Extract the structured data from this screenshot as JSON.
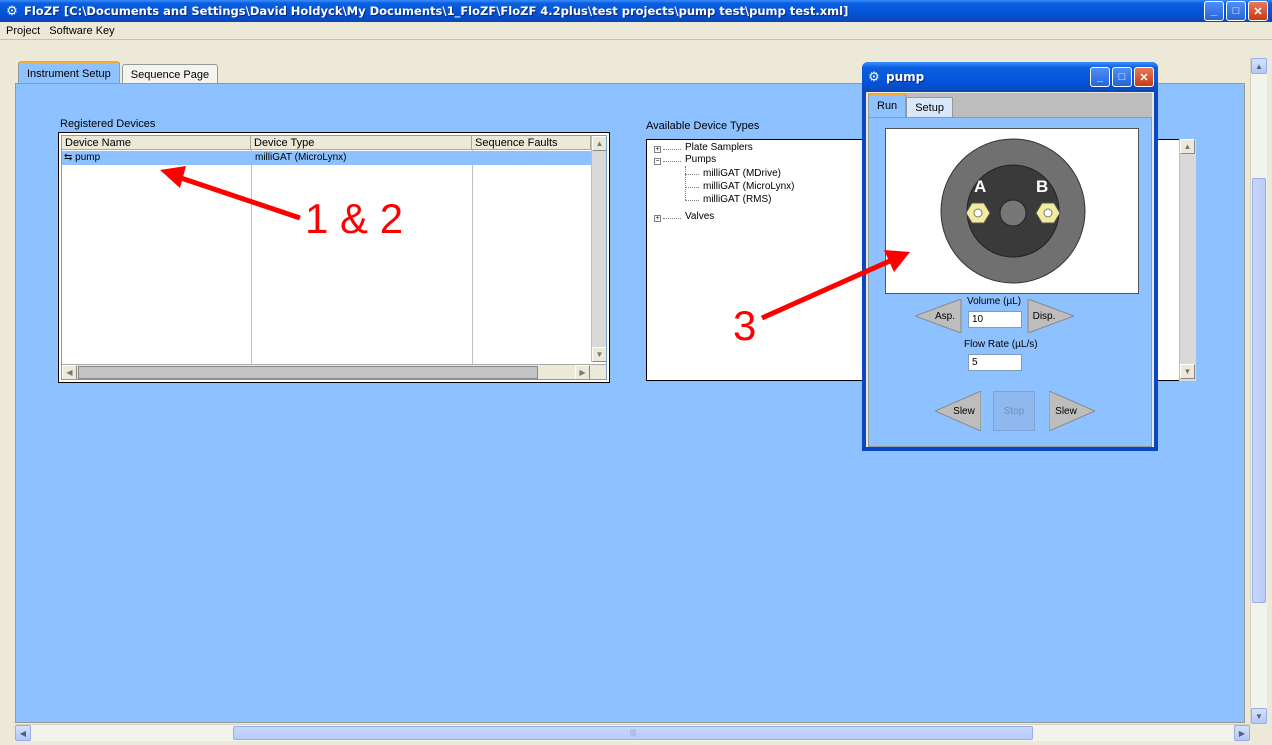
{
  "window": {
    "title": "FloZF [C:\\Documents and Settings\\David Holdyck\\My Documents\\1_FloZF\\FloZF 4.2plus\\test projects\\pump test\\pump test.xml]",
    "minimize": "_",
    "maximize": "□",
    "close": "✕"
  },
  "menu": [
    "Project",
    "Software Key"
  ],
  "tabs": [
    {
      "label": "Instrument Setup",
      "active": true
    },
    {
      "label": "Sequence Page",
      "active": false
    }
  ],
  "registered_devices": {
    "label": "Registered Devices",
    "columns": [
      "Device Name",
      "Device Type",
      "Sequence Faults"
    ],
    "rows": [
      {
        "name": "pump",
        "type": "milliGAT (MicroLynx)",
        "faults": ""
      }
    ]
  },
  "available_device_types": {
    "label": "Available Device Types",
    "tree": [
      {
        "label": "Plate Samplers",
        "expanded": false,
        "children": []
      },
      {
        "label": "Pumps",
        "expanded": true,
        "children": [
          "milliGAT (MDrive)",
          "milliGAT (MicroLynx)",
          "milliGAT (RMS)"
        ]
      },
      {
        "label": "Valves",
        "expanded": false,
        "children": []
      }
    ]
  },
  "pump_window": {
    "title": "pump",
    "tabs": [
      {
        "label": "Run",
        "active": true
      },
      {
        "label": "Setup",
        "active": false
      }
    ],
    "port_a": "A",
    "port_b": "B",
    "volume_label": "Volume (µL)",
    "volume_value": "10",
    "flow_label": "Flow Rate (µL/s)",
    "flow_value": "5",
    "asp_label": "Asp.",
    "disp_label": "Disp.",
    "slew_left": "Slew",
    "stop": "Stop",
    "slew_right": "Slew"
  },
  "annotations": {
    "a1": "1 & 2",
    "a3": "3"
  },
  "colors": {
    "panel_blue": "#8ec1ff",
    "arrow_red": "#ff0000",
    "title_blue": "#0453d6"
  }
}
